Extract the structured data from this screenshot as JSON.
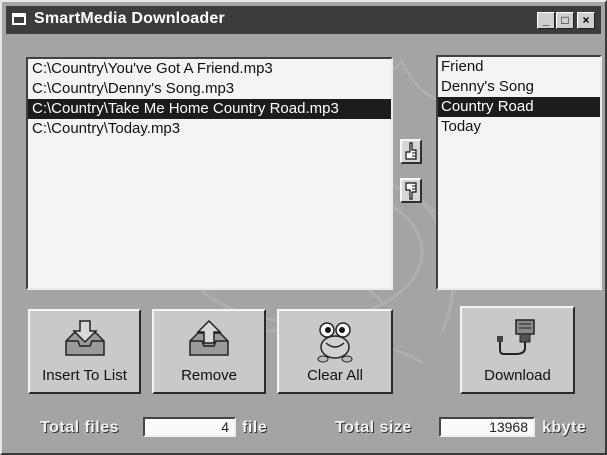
{
  "window": {
    "title": "SmartMedia Downloader",
    "controls": {
      "minimize": "_",
      "maximize": "□",
      "close": "×"
    }
  },
  "file_list": {
    "items": [
      "C:\\Country\\You've Got A Friend.mp3",
      "C:\\Country\\Denny's Song.mp3",
      "C:\\Country\\Take Me Home Country Road.mp3",
      "C:\\Country\\Today.mp3"
    ],
    "selected_index": 2
  },
  "title_list": {
    "items": [
      "Friend",
      "Denny's Song",
      "Country Road",
      "Today"
    ],
    "selected_index": 2
  },
  "order_buttons": {
    "up_icon": "hand-point-up-icon",
    "down_icon": "hand-point-down-icon"
  },
  "buttons": {
    "insert": {
      "label": "Insert To List",
      "icon": "inbox-down-arrow-icon"
    },
    "remove": {
      "label": "Remove",
      "icon": "inbox-up-arrow-icon"
    },
    "clear": {
      "label": "Clear All",
      "icon": "frog-character-icon"
    },
    "download": {
      "label": "Download",
      "icon": "device-connector-icon"
    }
  },
  "status": {
    "total_files_label": "Total files",
    "total_files_value": "4",
    "total_files_unit": "file",
    "total_size_label": "Total size",
    "total_size_value": "13968",
    "total_size_unit": "kbyte"
  },
  "colors": {
    "selection": "#1c1c1c",
    "titlebar": "#3c3c3c",
    "window": "#a4a4a4"
  }
}
